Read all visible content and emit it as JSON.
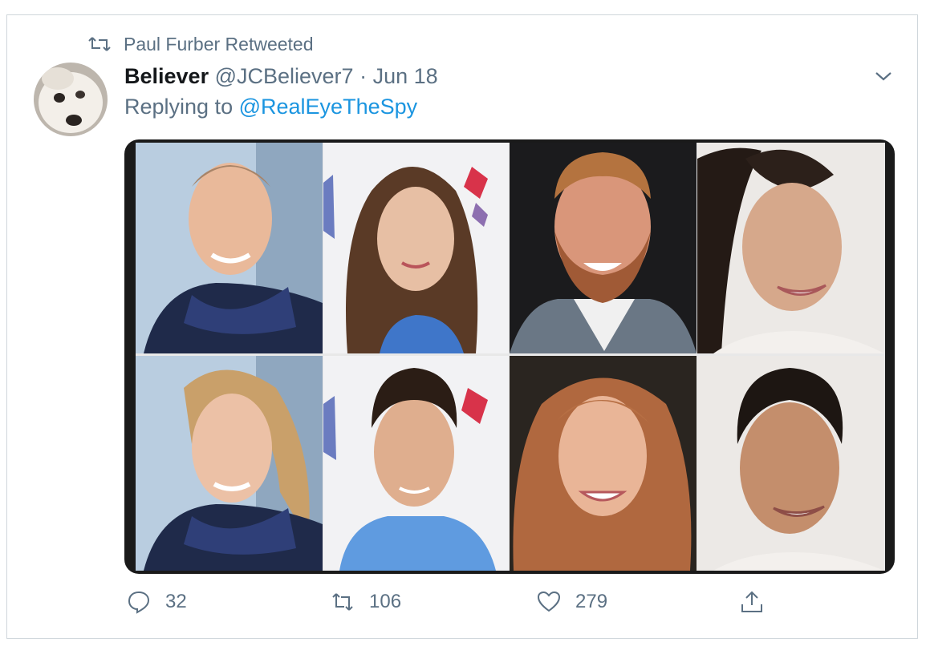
{
  "social_context": {
    "label": "Paul Furber Retweeted"
  },
  "tweet": {
    "display_name": "Believer",
    "handle": "@JCBeliever7",
    "separator": "·",
    "date": "Jun 18",
    "reply_prefix": "Replying to",
    "reply_to": "@RealEyeTheSpy"
  },
  "media": {
    "photos": [
      {
        "id": "row1-col1"
      },
      {
        "id": "row1-col2"
      },
      {
        "id": "row1-col3"
      },
      {
        "id": "row1-col4"
      },
      {
        "id": "row2-col1"
      },
      {
        "id": "row2-col2"
      },
      {
        "id": "row2-col3"
      },
      {
        "id": "row2-col4"
      }
    ]
  },
  "actions": {
    "reply": {
      "icon": "reply-icon",
      "count": "32"
    },
    "retweet": {
      "icon": "retweet-icon",
      "count": "106"
    },
    "like": {
      "icon": "like-icon",
      "count": "279"
    },
    "share": {
      "icon": "share-icon"
    }
  },
  "colors": {
    "link": "#1b95e0",
    "secondary_text": "#5b7083",
    "primary_text": "#14171a"
  }
}
